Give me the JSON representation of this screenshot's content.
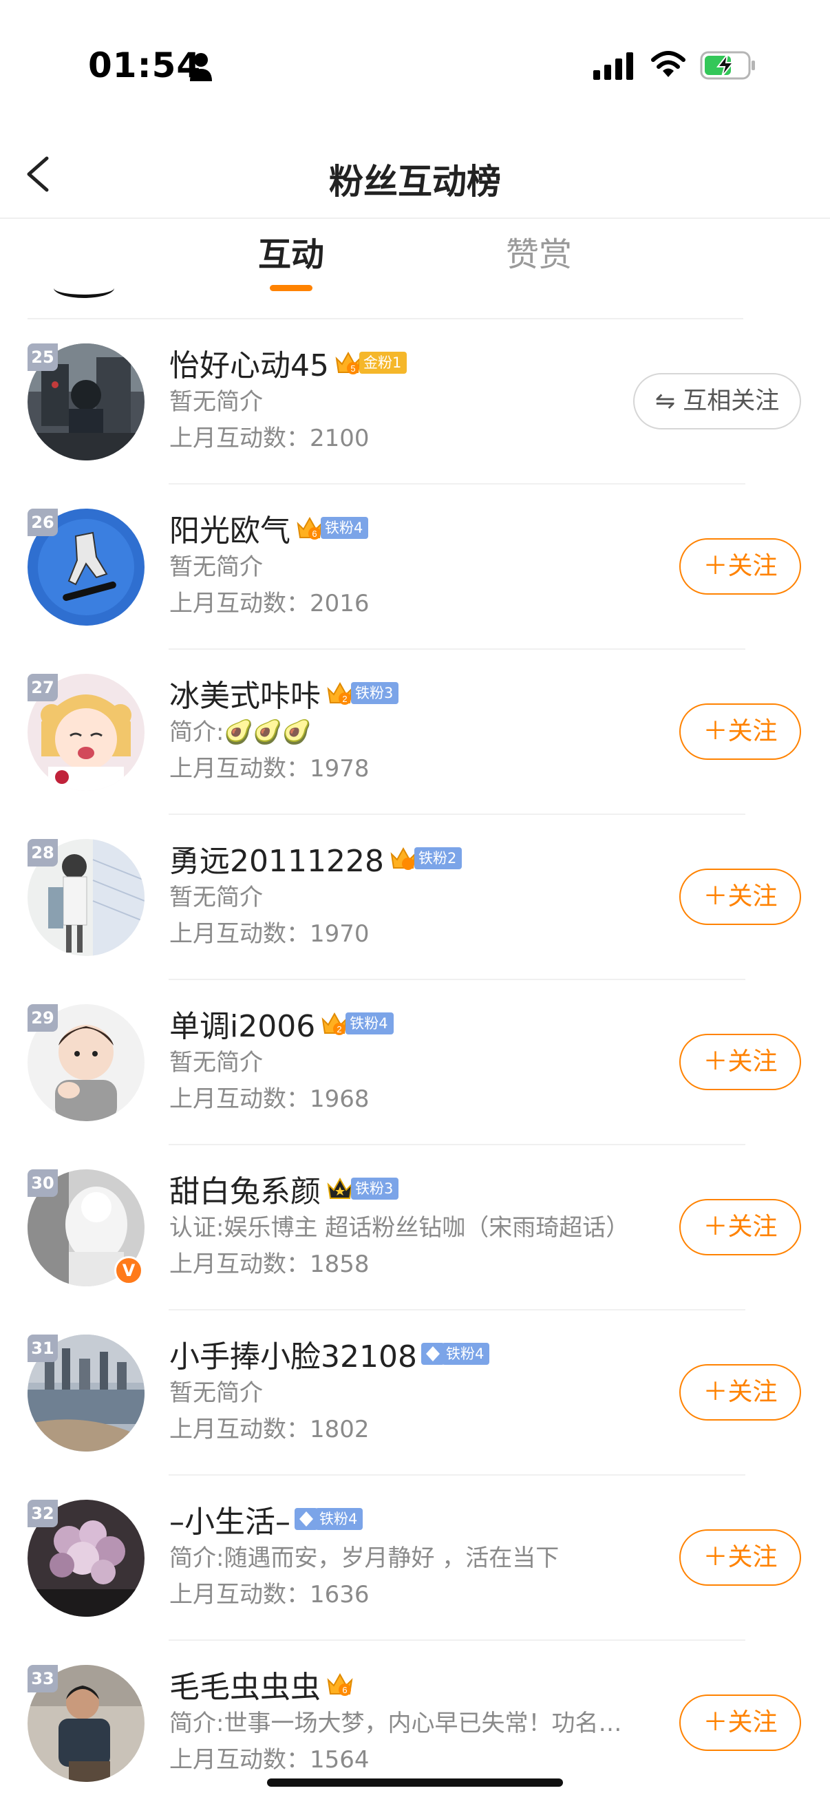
{
  "status_bar": {
    "time": "01:54"
  },
  "nav": {
    "title": "粉丝互动榜"
  },
  "tabs": [
    {
      "label": "互动",
      "active": true
    },
    {
      "label": "赞赏",
      "active": false
    }
  ],
  "colors": {
    "accent": "#ff8200",
    "iron_badge": "#7ba4e8",
    "gold_badge": "#f5b72a",
    "rank_badge": "#a6adbf"
  },
  "fans": [
    {
      "rank": "25",
      "name": "怡好心动45",
      "crown_level": "5",
      "badge": "金粉1",
      "bio": "暂无简介",
      "count_label": "上月互动数：",
      "count": "2100",
      "button": "⇋ 互相关注"
    },
    {
      "rank": "26",
      "name": "阳光欧气",
      "crown_level": "6",
      "badge": "铁粉4",
      "bio": "暂无简介",
      "count_label": "上月互动数：",
      "count": "2016",
      "button": "＋关注"
    },
    {
      "rank": "27",
      "name": "冰美式咔咔",
      "crown_level": "2",
      "badge": "铁粉3",
      "bio": "简介:🥑🥑🥑",
      "count_label": "上月互动数：",
      "count": "1978",
      "button": "＋关注"
    },
    {
      "rank": "28",
      "name": "勇远20111228",
      "crown_level": "",
      "badge": "铁粉2",
      "bio": "暂无简介",
      "count_label": "上月互动数：",
      "count": "1970",
      "button": "＋关注"
    },
    {
      "rank": "29",
      "name": "单调i2006",
      "crown_level": "2",
      "badge": "铁粉4",
      "bio": "暂无简介",
      "count_label": "上月互动数：",
      "count": "1968",
      "button": "＋关注"
    },
    {
      "rank": "30",
      "name": "甜白兔系颜",
      "crown_level": "",
      "badge": "铁粉3",
      "bio": "认证:娱乐博主 超话粉丝钻咖（宋雨琦超话）",
      "count_label": "上月互动数：",
      "count": "1858",
      "button": "＋关注",
      "verified": "V"
    },
    {
      "rank": "31",
      "name": "小手捧小脸32108",
      "crown_level": "",
      "badge": "铁粉4",
      "bio": "暂无简介",
      "count_label": "上月互动数：",
      "count": "1802",
      "button": "＋关注"
    },
    {
      "rank": "32",
      "name": "–小生活–",
      "crown_level": "",
      "badge": "铁粉4",
      "bio": "简介:随遇而安，岁月静好 ，活在当下",
      "count_label": "上月互动数：",
      "count": "1636",
      "button": "＋关注"
    },
    {
      "rank": "33",
      "name": "毛毛虫虫虫",
      "crown_level": "6",
      "badge": "",
      "bio": "简介:世事一场大梦，内心早已失常！功名…",
      "count_label": "上月互动数：",
      "count": "1564",
      "button": "＋关注"
    }
  ]
}
